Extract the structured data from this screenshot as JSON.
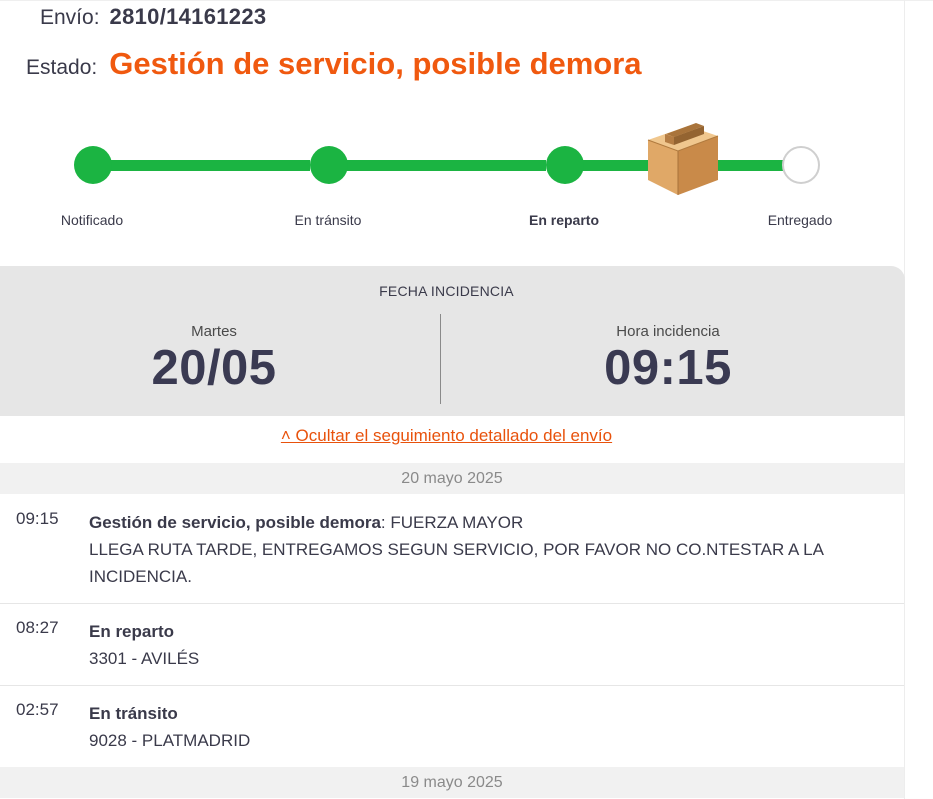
{
  "shipment": {
    "envio_label": "Envío:",
    "envio_number": "2810/14161223",
    "estado_label": "Estado:",
    "estado_value": "Gestión de servicio, posible demora",
    "estado_color": "#f0590f"
  },
  "tracker": {
    "steps": [
      {
        "label": "Notificado",
        "status": "done"
      },
      {
        "label": "En tránsito",
        "status": "done"
      },
      {
        "label": "En reparto",
        "status": "current"
      },
      {
        "label": "Entregado",
        "status": "pending"
      }
    ],
    "progress_color": "#1bb442",
    "current_icon": "package-box-icon"
  },
  "incident": {
    "title": "FECHA INCIDENCIA",
    "day_label": "Martes",
    "date": "20/05",
    "time_label": "Hora incidencia",
    "time": "09:15"
  },
  "toggle_link": "˄ Ocultar el seguimiento detallado del envío",
  "history": [
    {
      "date": "20 mayo 2025",
      "events": [
        {
          "time": "09:15",
          "title": "Gestión de servicio, posible demora",
          "suffix": ": FUERZA MAYOR",
          "detail": "LLEGA RUTA TARDE, ENTREGAMOS SEGUN SERVICIO, POR FAVOR NO CO.NTESTAR A LA INCIDENCIA."
        },
        {
          "time": "08:27",
          "title": "En reparto",
          "suffix": "",
          "detail": "3301 - AVILÉS"
        },
        {
          "time": "02:57",
          "title": "En tránsito",
          "suffix": "",
          "detail": "9028 - PLATMADRID"
        }
      ]
    },
    {
      "date": "19 mayo 2025",
      "events": []
    }
  ]
}
